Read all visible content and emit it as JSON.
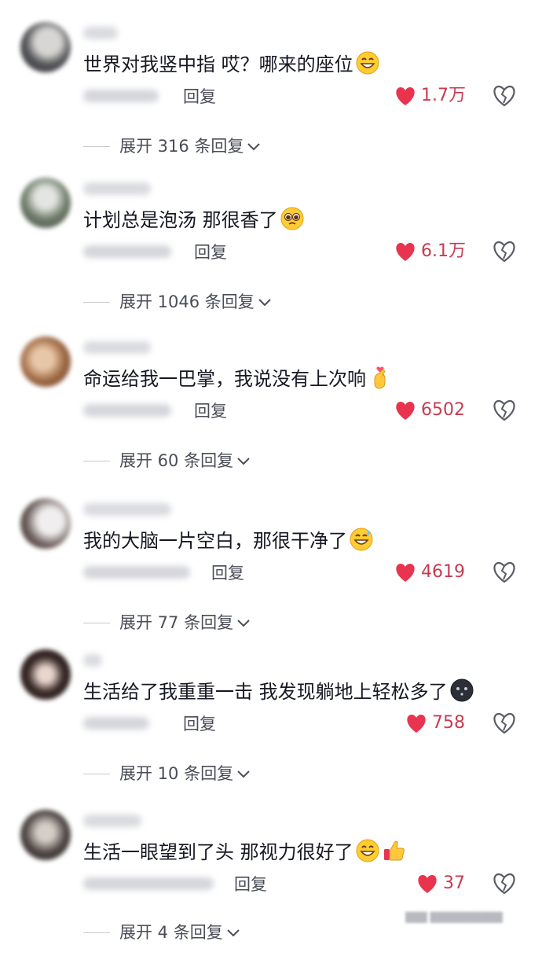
{
  "colors": {
    "like_red": "#e8344e",
    "count_red": "#c73b51",
    "text": "#161823",
    "muted": "#4a4d57"
  },
  "comments": [
    {
      "text": "世界对我竖中指 哎？哪来的座位",
      "emoji": "grin-emoji",
      "reply": "回复",
      "likes": "1.7万",
      "expand": "展开 316 条回复"
    },
    {
      "text": "计划总是泡汤 那很香了",
      "emoji": "pleading-emoji",
      "reply": "回复",
      "likes": "6.1万",
      "expand": "展开 1046 条回复"
    },
    {
      "text": "命运给我一巴掌，我说没有上次响",
      "emoji": "finger-heart-emoji",
      "reply": "回复",
      "likes": "6502",
      "expand": "展开 60 条回复"
    },
    {
      "text": "我的大脑一片空白，那很干净了",
      "emoji": "grin-sweat-emoji",
      "reply": "回复",
      "likes": "4619",
      "expand": "展开 77 条回复"
    },
    {
      "text": "生活给了我重重一击 我发现躺地上轻松多了",
      "emoji": "dark-face-emoji",
      "reply": "回复",
      "likes": "758",
      "expand": "展开 10 条回复"
    },
    {
      "text": "生活一眼望到了头 那视力很好了",
      "emoji": "grin-thumbs-emoji",
      "reply": "回复",
      "likes": "37",
      "expand": "展开 4 条回复"
    }
  ]
}
